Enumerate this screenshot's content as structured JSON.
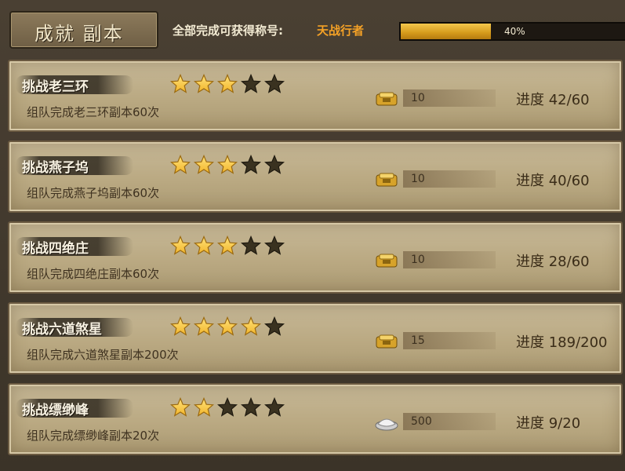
{
  "header": {
    "tab_label": "成就 副本",
    "note": "全部完成可获得称号:",
    "title_reward": "天战行者",
    "overall_progress_text": "40%",
    "overall_progress": 0.4
  },
  "colors": {
    "star_on": "#f2b52a",
    "star_off": "#3a3220",
    "title_reward": "#f4a126"
  },
  "achievements": [
    {
      "title": "挑战老三环",
      "desc": "组队完成老三环副本60次",
      "stars": 3,
      "max_stars": 5,
      "reward_icon": "gold-ingot-icon",
      "reward": "10",
      "progress": "进度 42/60"
    },
    {
      "title": "挑战燕子坞",
      "desc": "组队完成燕子坞副本60次",
      "stars": 3,
      "max_stars": 5,
      "reward_icon": "gold-ingot-icon",
      "reward": "10",
      "progress": "进度 40/60"
    },
    {
      "title": "挑战四绝庄",
      "desc": "组队完成四绝庄副本60次",
      "stars": 3,
      "max_stars": 5,
      "reward_icon": "gold-ingot-icon",
      "reward": "10",
      "progress": "进度 28/60"
    },
    {
      "title": "挑战六道煞星",
      "desc": "组队完成六道煞星副本200次",
      "stars": 4,
      "max_stars": 5,
      "reward_icon": "gold-ingot-icon",
      "reward": "15",
      "progress": "进度 189/200"
    },
    {
      "title": "挑战缥缈峰",
      "desc": "组队完成缥缈峰副本20次",
      "stars": 2,
      "max_stars": 5,
      "reward_icon": "silver-ingot-icon",
      "reward": "500",
      "progress": "进度 9/20"
    }
  ]
}
